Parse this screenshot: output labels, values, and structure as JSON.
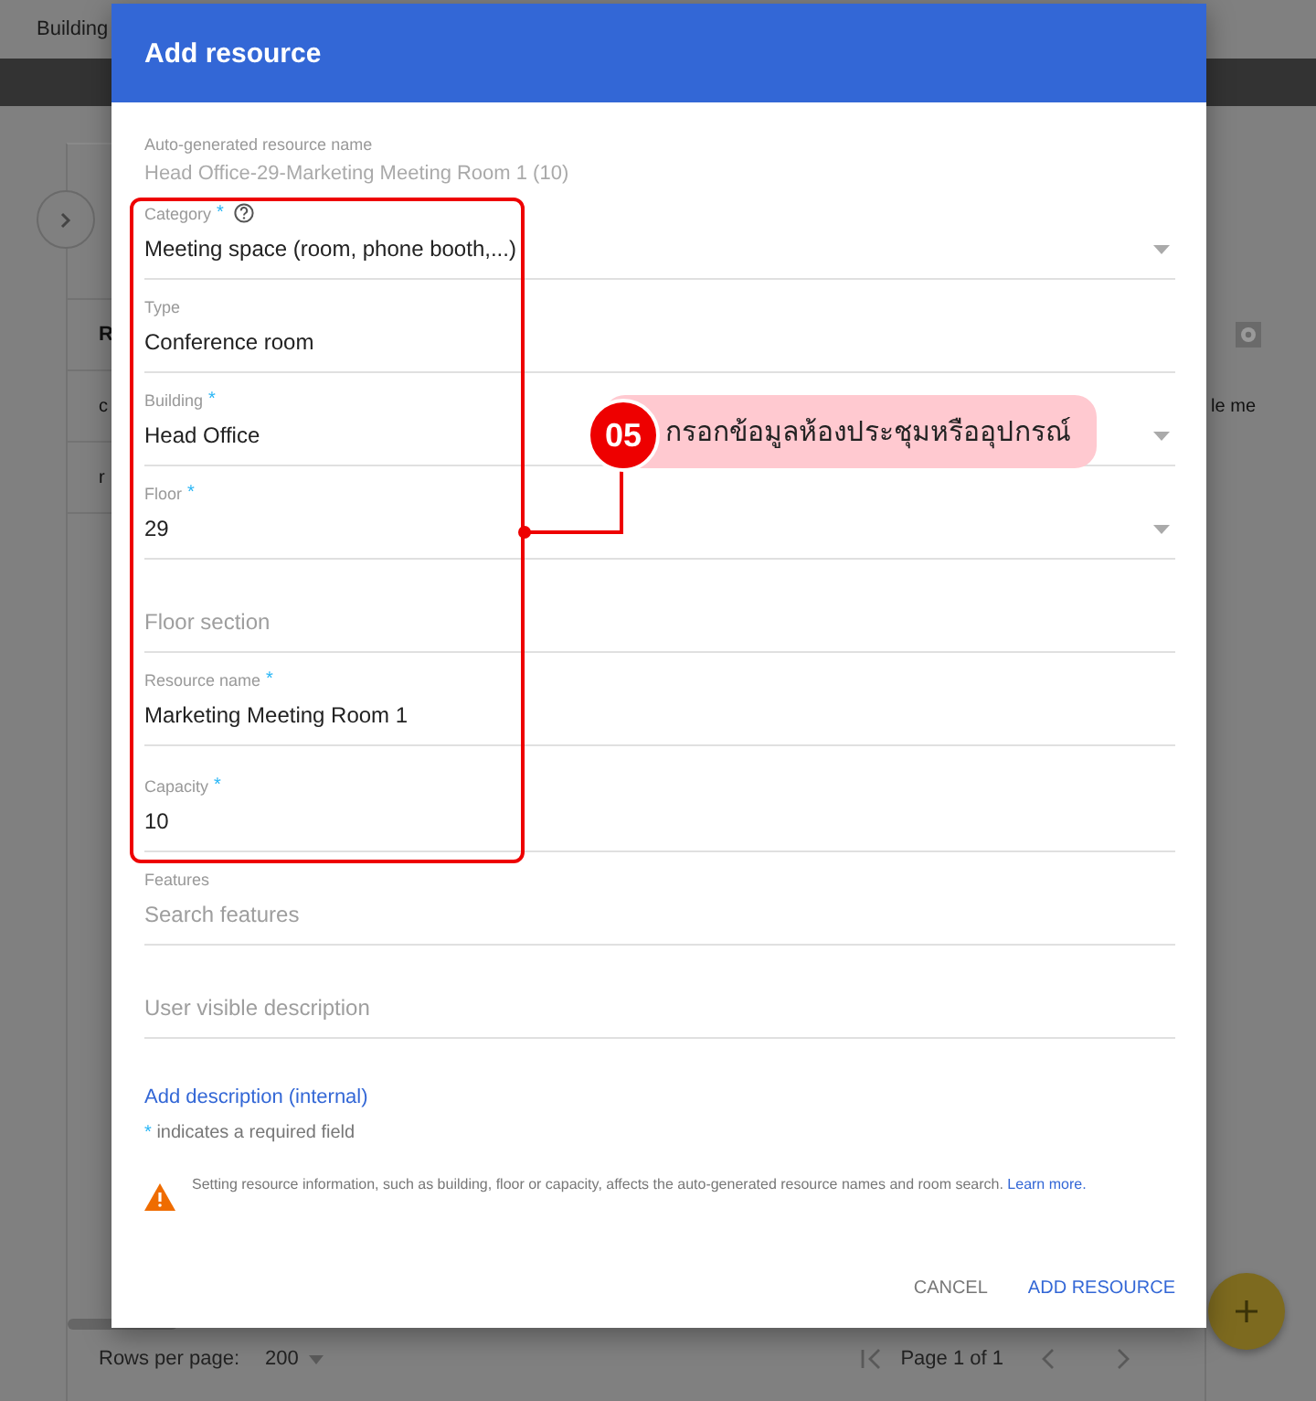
{
  "background": {
    "breadcrumb": "Building",
    "table_header": "R",
    "rows": [
      "c",
      "r"
    ],
    "row_cell_right": "le me",
    "rows_per_page_label": "Rows per page:",
    "rows_per_page": "200",
    "page_label": "Page 1 of 1"
  },
  "dialog": {
    "title": "Add resource",
    "generated_label": "Auto-generated resource name",
    "generated_value": "Head Office-29-Marketing Meeting Room 1 (10)",
    "required_mark": "*",
    "fields": [
      {
        "label": "Category",
        "required": true,
        "help": true,
        "value": "Meeting space (room, phone booth,...)",
        "dropdown": true
      },
      {
        "label": "Type",
        "required": false,
        "help": false,
        "value": "Conference room",
        "dropdown": false
      },
      {
        "label": "Building",
        "required": true,
        "help": false,
        "value": "Head Office",
        "dropdown": true
      },
      {
        "label": "Floor",
        "required": true,
        "help": false,
        "value": "29",
        "dropdown": true
      },
      {
        "required": false,
        "help": false,
        "placeholder": "Floor section",
        "dropdown": false
      },
      {
        "label": "Resource name",
        "required": true,
        "help": false,
        "value": "Marketing Meeting Room 1",
        "dropdown": false
      },
      {
        "label": "Capacity",
        "required": true,
        "help": false,
        "value": "10",
        "dropdown": false
      },
      {
        "label": "Features",
        "required": false,
        "help": false,
        "placeholder": "Search features",
        "dropdown": false
      },
      {
        "required": false,
        "help": false,
        "placeholder": "User visible description",
        "dropdown": false
      }
    ],
    "link": "Add description (internal)",
    "required_note": "indicates a required field",
    "warning": "Setting resource information, such as building, floor or capacity, affects the auto-generated resource names and room search.",
    "warning_link": "Learn more.",
    "buttons": [
      {
        "label": "CANCEL",
        "kind": "secondary"
      },
      {
        "label": "ADD RESOURCE",
        "kind": "primary"
      }
    ]
  },
  "annotation": {
    "number": "05",
    "text": "กรอกข้อมูลห้องประชุมหรืออุปกรณ์"
  }
}
